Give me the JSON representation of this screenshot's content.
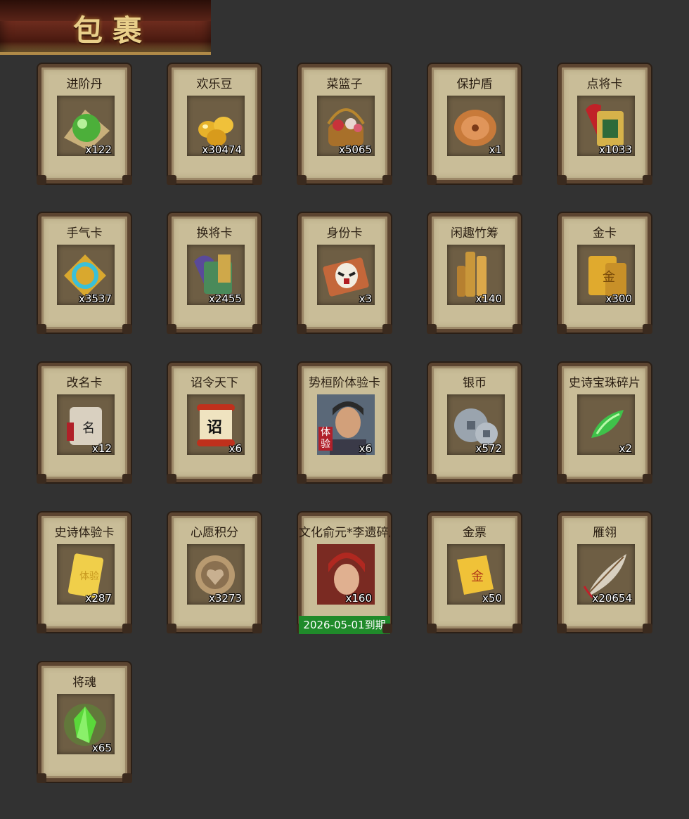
{
  "header": {
    "title": "包裹"
  },
  "items": [
    {
      "name": "进阶丹",
      "count": "x122",
      "icon": "green-orb-icon"
    },
    {
      "name": "欢乐豆",
      "count": "x30474",
      "icon": "gold-beans-icon"
    },
    {
      "name": "菜篮子",
      "count": "x5065",
      "icon": "flower-basket-icon"
    },
    {
      "name": "保护盾",
      "count": "x1",
      "icon": "round-shield-icon"
    },
    {
      "name": "点将卡",
      "count": "x1033",
      "icon": "general-card-icon"
    },
    {
      "name": "手气卡",
      "count": "x3537",
      "icon": "luck-card-icon"
    },
    {
      "name": "换将卡",
      "count": "x2455",
      "icon": "swap-card-icon"
    },
    {
      "name": "身份卡",
      "count": "x3",
      "icon": "mask-card-icon"
    },
    {
      "name": "闲趣竹筹",
      "count": "x140",
      "icon": "bamboo-tokens-icon"
    },
    {
      "name": "金卡",
      "count": "x300",
      "icon": "gold-card-icon"
    },
    {
      "name": "改名卡",
      "count": "x12",
      "icon": "rename-scroll-icon"
    },
    {
      "name": "诏令天下",
      "count": "x6",
      "icon": "edict-scroll-icon"
    },
    {
      "name": "势桓阶体验卡",
      "count": "x6",
      "icon": "hero-portrait-icon",
      "tag": "体验"
    },
    {
      "name": "银币",
      "count": "x572",
      "icon": "silver-coins-icon"
    },
    {
      "name": "史诗宝珠碎片",
      "count": "x2",
      "icon": "green-shard-icon"
    },
    {
      "name": "史诗体验卡",
      "count": "x287",
      "icon": "gold-ticket-icon"
    },
    {
      "name": "心愿积分",
      "count": "x3273",
      "icon": "heart-coin-icon"
    },
    {
      "name": "文化俞元*李遗碎片",
      "count": "x160",
      "icon": "warrior-portrait-icon",
      "expiry": "2026-05-01到期"
    },
    {
      "name": "金票",
      "count": "x50",
      "icon": "gold-scroll-icon"
    },
    {
      "name": "雁翎",
      "count": "x20654",
      "icon": "feather-icon"
    },
    {
      "name": "将魂",
      "count": "x65",
      "icon": "green-crystal-icon"
    }
  ]
}
